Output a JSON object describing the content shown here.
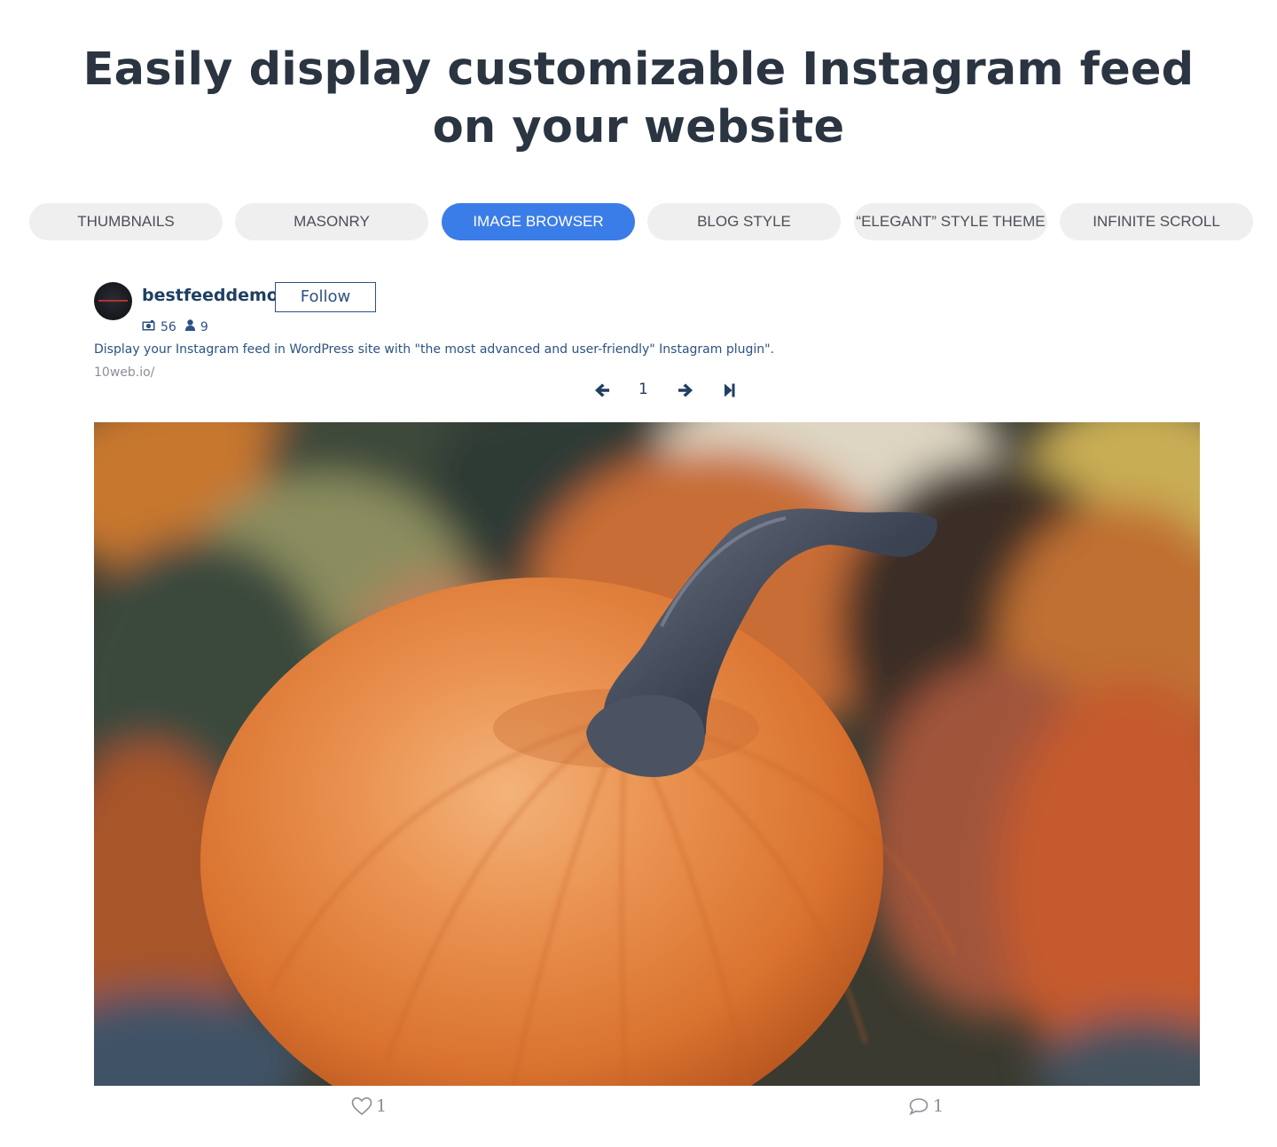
{
  "headline": {
    "line1": "Easily display customizable Instagram feed",
    "line2": "on your website"
  },
  "tabs": [
    {
      "label": "THUMBNAILS",
      "active": false
    },
    {
      "label": "MASONRY",
      "active": false
    },
    {
      "label": "IMAGE BROWSER",
      "active": true
    },
    {
      "label": "BLOG STYLE",
      "active": false
    },
    {
      "label": "“ELEGANT” STYLE THEME",
      "active": false
    },
    {
      "label": "INFINITE SCROLL",
      "active": false
    }
  ],
  "profile": {
    "username": "bestfeeddemo",
    "follow_label": "Follow",
    "posts_count": "56",
    "followers_count": "9",
    "bio": "Display your Instagram feed in WordPress site with \"the most advanced and user-friendly\" Instagram plugin\".",
    "website": "10web.io/"
  },
  "pager": {
    "current_page": "1",
    "prev_icon": "arrow-left-icon",
    "next_icon": "arrow-right-icon",
    "last_icon": "skip-to-last-icon"
  },
  "post": {
    "likes": "1",
    "comments": "1",
    "like_icon": "heart-outline-icon",
    "comment_icon": "speech-bubble-icon"
  },
  "colors": {
    "accent": "#3b7de8",
    "tab_bg": "#efefef",
    "heading": "#2b3441",
    "profile_text": "#2c5282"
  }
}
